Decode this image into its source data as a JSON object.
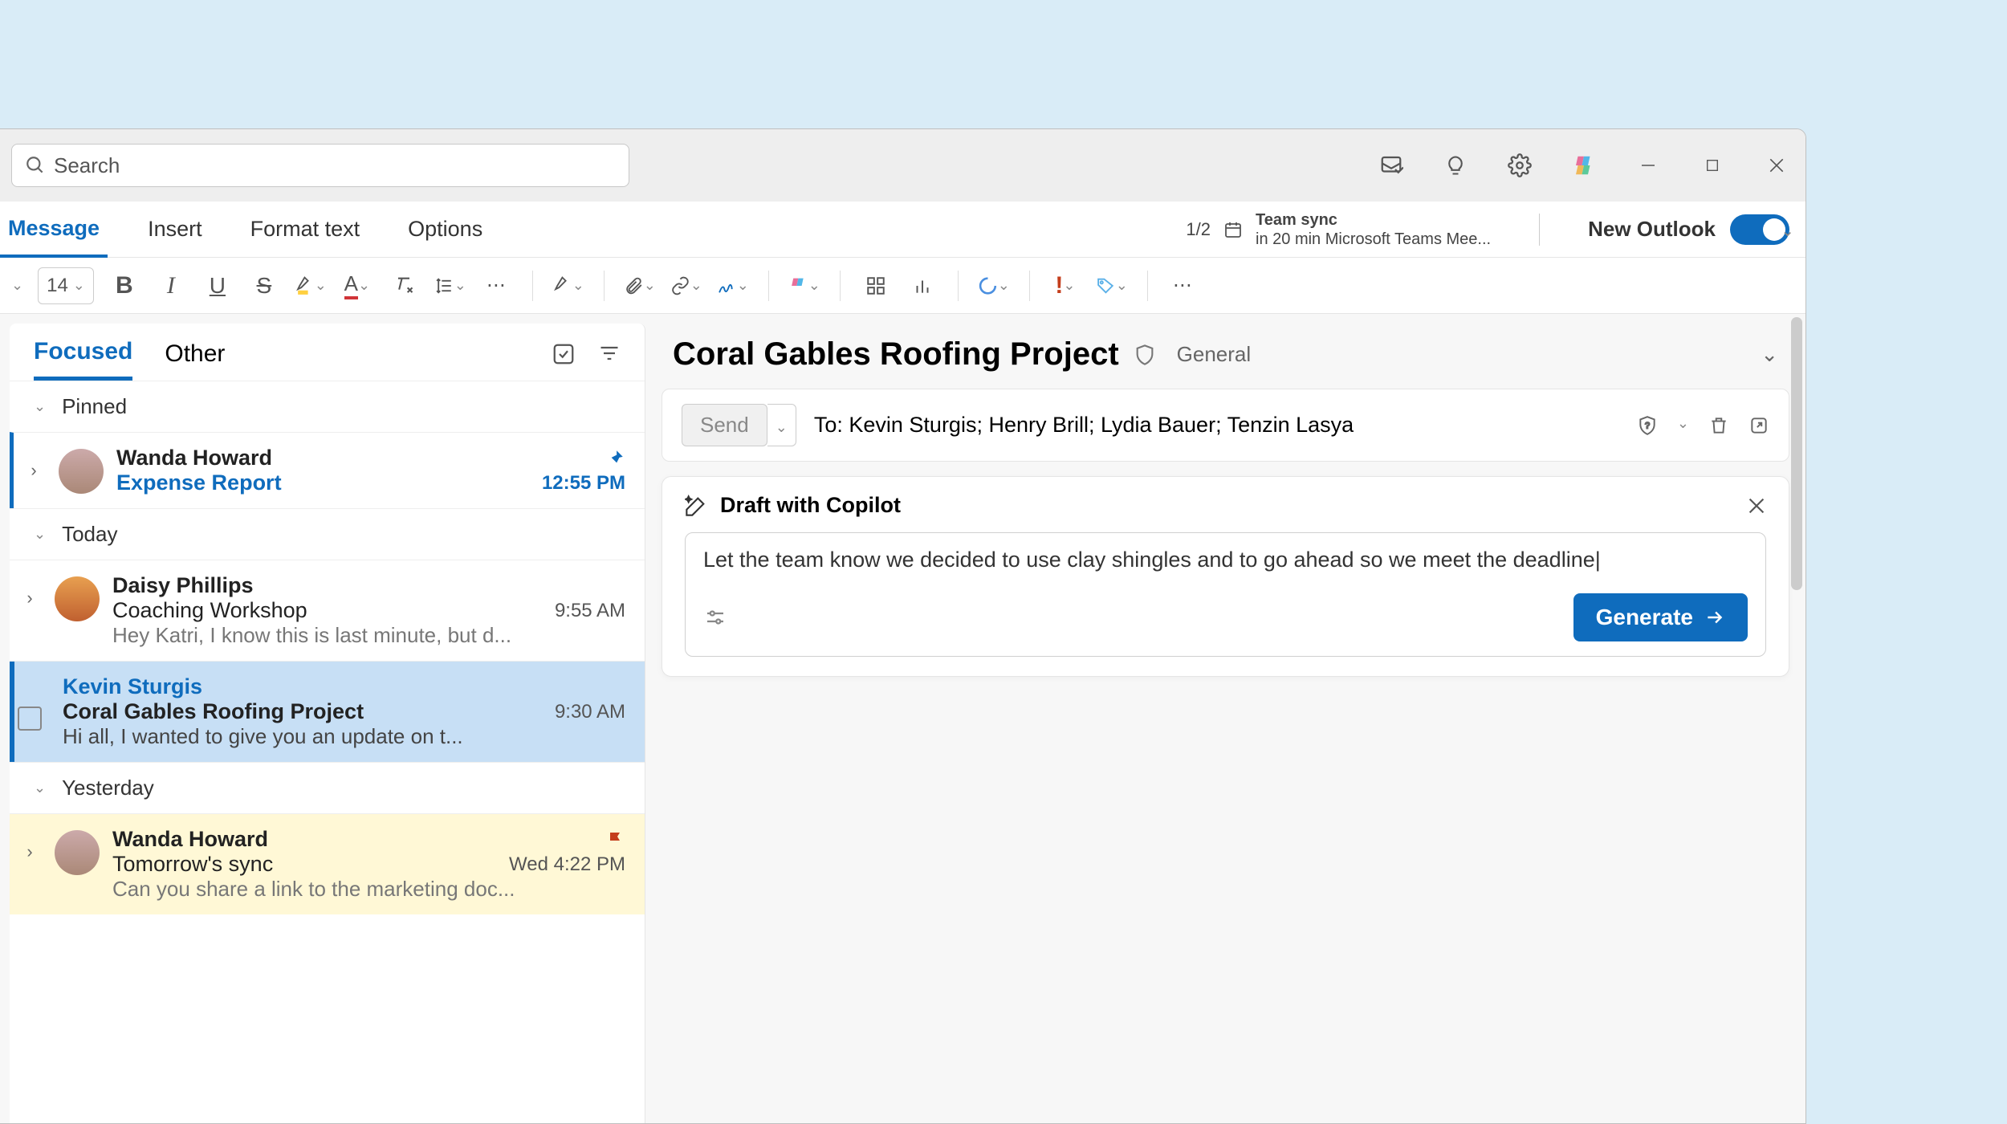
{
  "search": {
    "placeholder": "Search"
  },
  "menu": {
    "message": "Message",
    "insert": "Insert",
    "format": "Format text",
    "options": "Options"
  },
  "reminder": {
    "count": "1/2",
    "title": "Team sync",
    "detail": "in 20 min Microsoft Teams Mee..."
  },
  "newOutlook": "New Outlook",
  "fontSize": "14",
  "listTabs": {
    "focused": "Focused",
    "other": "Other"
  },
  "sections": {
    "pinned": "Pinned",
    "today": "Today",
    "yesterday": "Yesterday"
  },
  "msgs": {
    "m1": {
      "from": "Wanda Howard",
      "subj": "Expense Report",
      "time": "12:55 PM"
    },
    "m2": {
      "from": "Daisy Phillips",
      "subj": "Coaching Workshop",
      "time": "9:55 AM",
      "prev": "Hey Katri, I know this is last minute, but d..."
    },
    "m3": {
      "from": "Kevin Sturgis",
      "subj": "Coral Gables Roofing Project",
      "time": "9:30 AM",
      "prev": "Hi all, I wanted to give you an update on t..."
    },
    "m4": {
      "from": "Wanda Howard",
      "subj": "Tomorrow's sync",
      "time": "Wed 4:22 PM",
      "prev": "Can you share a link to the marketing doc..."
    }
  },
  "read": {
    "title": "Coral Gables Roofing Project",
    "general": "General"
  },
  "compose": {
    "send": "Send",
    "toLabel": "To:",
    "to": "Kevin Sturgis; Henry Brill; Lydia Bauer; Tenzin Lasya"
  },
  "copilot": {
    "title": "Draft with Copilot",
    "prompt": "Let the team know we decided to use clay shingles and to go ahead so we meet the deadline|",
    "generate": "Generate"
  }
}
